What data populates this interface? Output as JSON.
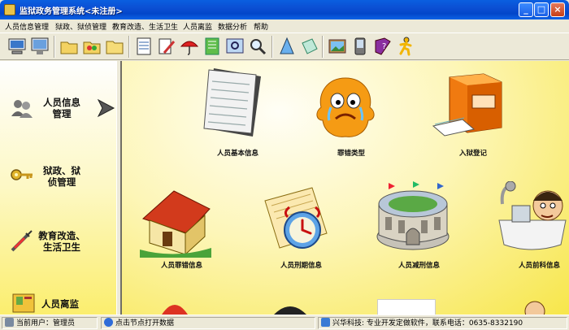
{
  "window": {
    "title": "监狱政务管理系统<未注册>"
  },
  "menu": [
    "人员信息管理",
    "狱政、狱侦管理",
    "教育改造、生活卫生",
    "人员离监",
    "数据分析",
    "帮助"
  ],
  "toolbar": {
    "buttons": [
      "computer-icon",
      "monitor-icon",
      "folder-icon",
      "folder-users-icon",
      "folder-open-icon",
      "report-icon",
      "edit-icon",
      "umbrella-icon",
      "notebook-icon",
      "image-search-icon",
      "magnifier-icon",
      "cone-icon",
      "note-icon",
      "picture-icon",
      "pda-icon",
      "help-book-icon",
      "runner-icon"
    ]
  },
  "nav": [
    {
      "label": "人员信息\n管理",
      "icon": "users-icon"
    },
    {
      "label": "狱政、狱\n侦管理",
      "icon": "key-icon"
    },
    {
      "label": "教育改造、\n生活卫生",
      "icon": "syringe-icon"
    },
    {
      "label": "人员离监",
      "icon": "book-icon"
    }
  ],
  "tiles": [
    {
      "label": "人员基本信息",
      "icon": "document-icon"
    },
    {
      "label": "罪错类型",
      "icon": "crying-blob-icon"
    },
    {
      "label": "入狱登记",
      "icon": "filing-cabinet-icon"
    },
    {
      "label": "人员罪错信息",
      "icon": "house-icon"
    },
    {
      "label": "人员刑期信息",
      "icon": "clock-paper-icon"
    },
    {
      "label": "人员减刑信息",
      "icon": "stadium-icon"
    },
    {
      "label": "人员前科信息",
      "icon": "bathtub-man-icon"
    }
  ],
  "status": {
    "user": "当前用户：管理员",
    "hint": "点击节点打开数据",
    "company": "兴华科技: 专业开发定做软件，联系电话：0635-8332190"
  },
  "colors": {
    "titlebar": "#0a5fe0",
    "panel": "#fbee6e",
    "main": "#f7e64a"
  }
}
